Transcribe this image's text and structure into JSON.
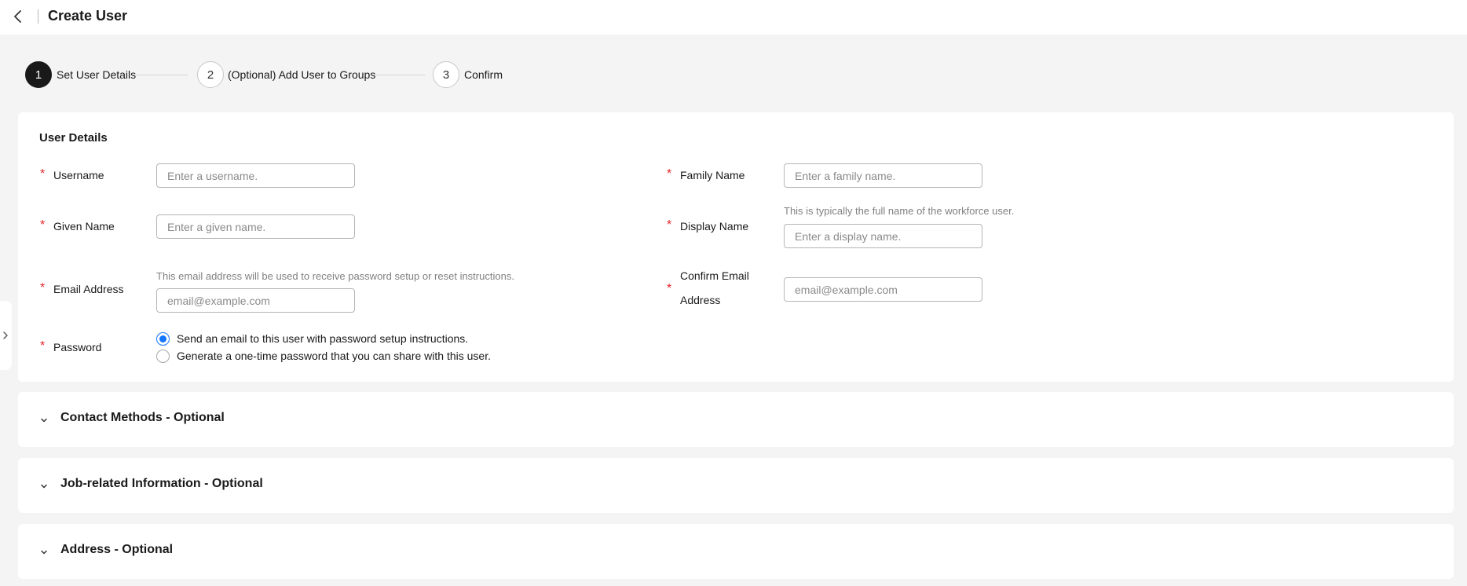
{
  "header": {
    "title": "Create User",
    "back_icon": "chevron-left-icon"
  },
  "steps": [
    {
      "number": "1",
      "label": "Set User Details",
      "state": "active"
    },
    {
      "number": "2",
      "label": "(Optional) Add User to Groups",
      "state": "pending"
    },
    {
      "number": "3",
      "label": "Confirm",
      "state": "pending"
    }
  ],
  "user_details": {
    "title": "User Details",
    "required_mark": "*",
    "username": {
      "label": "Username",
      "placeholder": "Enter a username.",
      "value": ""
    },
    "family_name": {
      "label": "Family Name",
      "placeholder": "Enter a family name.",
      "value": ""
    },
    "given_name": {
      "label": "Given Name",
      "placeholder": "Enter a given name.",
      "value": ""
    },
    "display_name": {
      "label": "Display Name",
      "placeholder": "Enter a display name.",
      "hint": "This is typically the full name of the workforce user.",
      "value": ""
    },
    "email": {
      "label": "Email Address",
      "placeholder": "email@example.com",
      "hint": "This email address will be used to receive password setup or reset instructions.",
      "value": ""
    },
    "confirm_email": {
      "label_line1": "Confirm Email",
      "label_line2": "Address",
      "placeholder": "email@example.com",
      "value": ""
    },
    "password": {
      "label": "Password",
      "options": [
        {
          "label": "Send an email to this user with password setup instructions.",
          "checked": true
        },
        {
          "label": "Generate a one-time password that you can share with this user.",
          "checked": false
        }
      ]
    }
  },
  "sections": [
    {
      "title": "Contact Methods - Optional",
      "icon": "chevron-down-icon",
      "expanded": false
    },
    {
      "title": "Job-related Information - Optional",
      "icon": "chevron-down-icon",
      "expanded": false
    },
    {
      "title": "Address - Optional",
      "icon": "chevron-down-icon",
      "expanded": false
    }
  ],
  "side_tab": {
    "icon": "chevron-right-icon"
  },
  "colors": {
    "accent": "#1476ff",
    "required": "#e5262c",
    "background": "#f4f4f4",
    "active_step": "#191919"
  }
}
